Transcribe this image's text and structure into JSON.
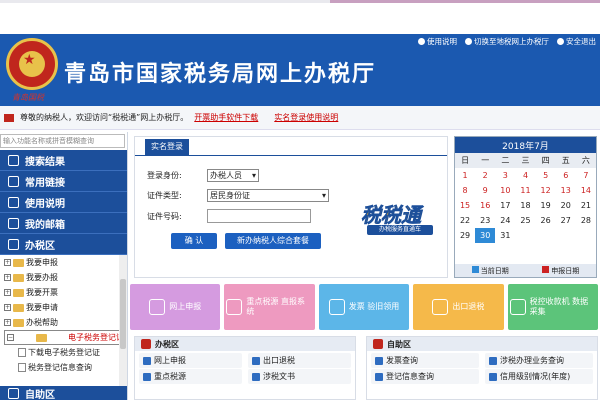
{
  "header": {
    "title": "青岛市国家税务局网上办税厅",
    "emblem_caption": "青岛国税",
    "toplinks": [
      "使用说明",
      "切换至地税网上办税厅",
      "安全退出"
    ]
  },
  "welcome": {
    "text": "尊敬的纳税人，欢迎访问“税税通”网上办税厅。",
    "link1": "开票助手软件下载",
    "link2": "实名登录使用说明"
  },
  "sidebar": {
    "search_placeholder": "输入功能名称或拼音模糊查询",
    "items": [
      {
        "label": "搜索结果"
      },
      {
        "label": "常用链接"
      },
      {
        "label": "使用说明"
      },
      {
        "label": "我的邮箱"
      },
      {
        "label": "办税区"
      }
    ],
    "tree": [
      {
        "label": "我要申报"
      },
      {
        "label": "我要办报"
      },
      {
        "label": "我要开票"
      },
      {
        "label": "我要申请"
      },
      {
        "label": "办税帮助"
      },
      {
        "label": "电子税务登记证"
      }
    ],
    "tree_children": [
      {
        "label": "下载电子税务登记证"
      },
      {
        "label": "税务登记信息查询"
      }
    ],
    "bottom_item": "自助区"
  },
  "login": {
    "tab": "实名登录",
    "role_label": "登录身份:",
    "role_value": "办税人员",
    "cert_label": "证件类型:",
    "cert_value": "居民身份证",
    "num_label": "证件号码:",
    "confirm_button": "确 认",
    "register_button": "新办纳税人综合套餐",
    "badge_title": "税税通",
    "badge_sub": "办税服务直通车"
  },
  "calendar": {
    "title": "2018年7月",
    "weekdays": [
      "日",
      "一",
      "二",
      "三",
      "四",
      "五",
      "六"
    ],
    "weeks": [
      [
        "1",
        "2",
        "3",
        "4",
        "5",
        "6",
        "7"
      ],
      [
        "8",
        "9",
        "10",
        "11",
        "12",
        "13",
        "14"
      ],
      [
        "15",
        "16",
        "17",
        "18",
        "19",
        "20",
        "21"
      ],
      [
        "22",
        "23",
        "24",
        "25",
        "26",
        "27",
        "28"
      ],
      [
        "29",
        "30",
        "31",
        "",
        "",
        "",
        ""
      ]
    ],
    "legend_current": "当前日期",
    "legend_filing": "申报日期",
    "current_color": "#2e8ad6",
    "filing_color": "#cc2222"
  },
  "tiles": [
    {
      "label": "网上申报",
      "color": "#d59be0"
    },
    {
      "label": "重点税源 直报系统",
      "color": "#ee9ac0"
    },
    {
      "label": "发票 验旧领用",
      "color": "#5cb6e8"
    },
    {
      "label": "出口退税",
      "color": "#f5b94a"
    },
    {
      "label": "税控收款机 数据采集",
      "color": "#5cc47a"
    }
  ],
  "panel_left": {
    "title": "办税区",
    "links": [
      "网上申报",
      "出口退税",
      "重点税源",
      "涉税文书"
    ]
  },
  "panel_right": {
    "title": "自助区",
    "links": [
      "发票查询",
      "涉税办理业务查询",
      "登记信息查询",
      "信用级别情况(年度)"
    ]
  }
}
